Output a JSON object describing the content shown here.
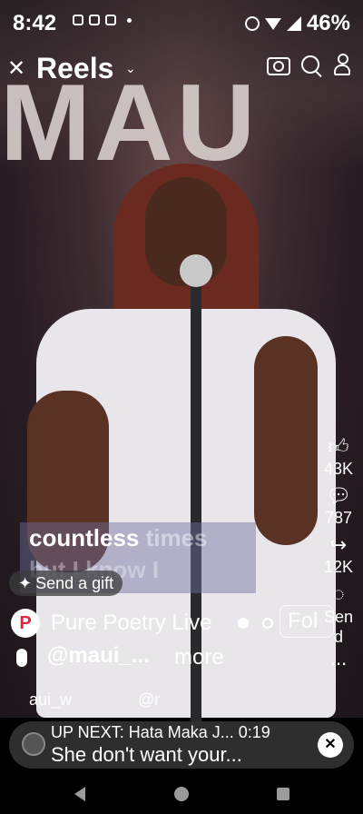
{
  "status_bar": {
    "time": "8:42",
    "battery": "46%"
  },
  "header": {
    "title": "Reels",
    "chevron": "⌄"
  },
  "video": {
    "background_text": "MAU",
    "caption_line1_bold": "countless",
    "caption_line1_faded": " times",
    "caption_line2": "but I know I"
  },
  "rail": {
    "likes": "43K",
    "comments": "787",
    "shares": "12K",
    "send_label": "Sen\nd",
    "send_line1": "Sen",
    "send_line2": "d",
    "more": "..."
  },
  "gift": {
    "label": "Send a gift"
  },
  "channel": {
    "avatar_letter": "P",
    "name": "Pure Poetry Live",
    "follow_label": "Fol"
  },
  "user": {
    "handle": "@maui_...",
    "more": "more"
  },
  "tagline": {
    "left": "aui_w",
    "right": "@r"
  },
  "up_next": {
    "line1": "UP NEXT: Hata Maka J... 0:19",
    "line2": "She don't want your..."
  },
  "colors": {
    "accent_red": "#e4233d",
    "bar_bg": "#2e2e2e"
  }
}
